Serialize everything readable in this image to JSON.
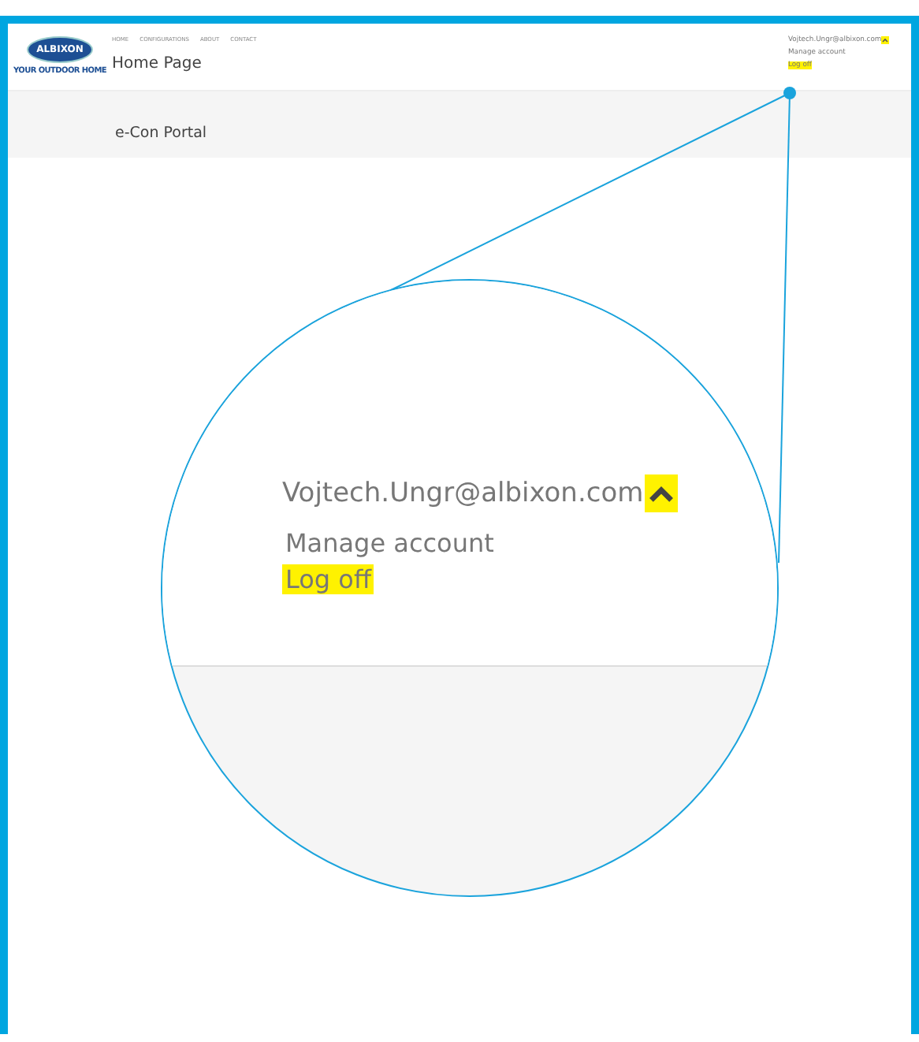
{
  "header": {
    "logo": {
      "name": "ALBIXON",
      "tagline": "YOUR OUTDOOR HOME"
    },
    "nav": [
      "HOME",
      "CONFIGURATIONS",
      "ABOUT",
      "CONTACT"
    ],
    "title": "Home Page",
    "user": {
      "email": "Vojtech.Ungr@albixon.com",
      "caret_highlighted": true,
      "links": [
        {
          "label": "Manage account",
          "highlighted": false
        },
        {
          "label": "Log off",
          "highlighted": true
        }
      ]
    }
  },
  "banner": {
    "title": "e-Con Portal"
  },
  "magnifier": {
    "email": "Vojtech.Ungr@albixon.com",
    "caret_highlighted": true,
    "links": [
      {
        "label": "Manage account",
        "highlighted": false
      },
      {
        "label": "Log off",
        "highlighted": true
      }
    ]
  }
}
